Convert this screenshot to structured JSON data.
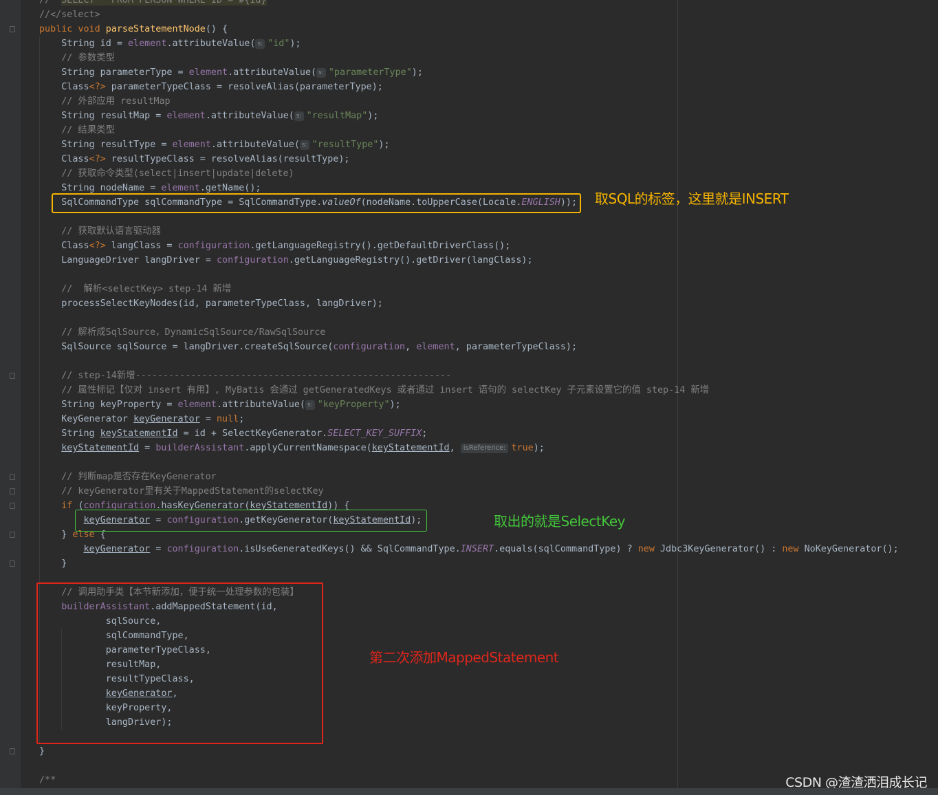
{
  "editor": {
    "lines": [
      [
        [
          "//  ",
          "cmt"
        ],
        [
          "SELECT * FROM PERSON WHERE ID = #{id}",
          "cmt hl"
        ]
      ],
      [
        [
          "//</select>",
          "cmt"
        ]
      ],
      [
        [
          "public void ",
          "kw"
        ],
        [
          "parseStatementNode",
          "fn"
        ],
        [
          "() {",
          ""
        ]
      ],
      [
        [
          "    String id = ",
          ""
        ],
        [
          "element",
          "fld"
        ],
        [
          ".attributeValue(",
          ""
        ],
        [
          "s:",
          "hint-s"
        ],
        [
          "\"id\"",
          "str"
        ],
        [
          ");",
          ""
        ]
      ],
      [
        [
          "    // 参数类型",
          "cmt"
        ]
      ],
      [
        [
          "    String parameterType = ",
          ""
        ],
        [
          "element",
          "fld"
        ],
        [
          ".attributeValue(",
          ""
        ],
        [
          "s:",
          "hint-s"
        ],
        [
          "\"parameterType\"",
          "str"
        ],
        [
          ");",
          ""
        ]
      ],
      [
        [
          "    Class",
          ""
        ],
        [
          "<?>",
          "kw"
        ],
        [
          " parameterTypeClass = resolveAlias(parameterType);",
          ""
        ]
      ],
      [
        [
          "    // 外部应用 resultMap",
          "cmt"
        ]
      ],
      [
        [
          "    String resultMap = ",
          ""
        ],
        [
          "element",
          "fld"
        ],
        [
          ".attributeValue(",
          ""
        ],
        [
          "s:",
          "hint-s"
        ],
        [
          "\"resultMap\"",
          "str"
        ],
        [
          ");",
          ""
        ]
      ],
      [
        [
          "    // 结果类型",
          "cmt"
        ]
      ],
      [
        [
          "    String resultType = ",
          ""
        ],
        [
          "element",
          "fld"
        ],
        [
          ".attributeValue(",
          ""
        ],
        [
          "s:",
          "hint-s"
        ],
        [
          "\"resultType\"",
          "str"
        ],
        [
          ");",
          ""
        ]
      ],
      [
        [
          "    Class",
          ""
        ],
        [
          "<?>",
          "kw"
        ],
        [
          " resultTypeClass = resolveAlias(resultType);",
          ""
        ]
      ],
      [
        [
          "    // 获取命令类型(select|insert|update|delete)",
          "cmt"
        ]
      ],
      [
        [
          "    String nodeName = ",
          ""
        ],
        [
          "element",
          "fld"
        ],
        [
          ".getName();",
          ""
        ]
      ],
      [
        [
          "    SqlCommandType sqlCommandType = SqlCommandType.",
          ""
        ],
        [
          "valueOf",
          "it"
        ],
        [
          "(nodeName.toUpperCase(Locale.",
          ""
        ],
        [
          "ENGLISH",
          "fld it"
        ],
        [
          "));",
          ""
        ]
      ],
      [],
      [
        [
          "    // 获取默认语言驱动器",
          "cmt"
        ]
      ],
      [
        [
          "    Class",
          ""
        ],
        [
          "<?>",
          "kw"
        ],
        [
          " langClass = ",
          ""
        ],
        [
          "configuration",
          "fld"
        ],
        [
          ".getLanguageRegistry().getDefaultDriverClass();",
          ""
        ]
      ],
      [
        [
          "    LanguageDriver langDriver = ",
          ""
        ],
        [
          "configuration",
          "fld"
        ],
        [
          ".getLanguageRegistry().getDriver(langClass);",
          ""
        ]
      ],
      [],
      [
        [
          "    //  解析<selectKey> step-14 新增",
          "cmt"
        ]
      ],
      [
        [
          "    processSelectKeyNodes(id, parameterTypeClass, langDriver);",
          ""
        ]
      ],
      [],
      [
        [
          "    // 解析成SqlSource，DynamicSqlSource/RawSqlSource",
          "cmt"
        ]
      ],
      [
        [
          "    SqlSource sqlSource = langDriver.createSqlSource(",
          ""
        ],
        [
          "configuration",
          "fld"
        ],
        [
          ", ",
          ""
        ],
        [
          "element",
          "fld"
        ],
        [
          ", parameterTypeClass);",
          ""
        ]
      ],
      [],
      [
        [
          "    // step-14新增---------------------------------------------------------",
          "cmt"
        ]
      ],
      [
        [
          "    // 属性标记【仅对 insert 有用】, MyBatis 会通过 getGeneratedKeys 或者通过 insert 语句的 selectKey 子元素设置它的值 step-14 新增",
          "cmt"
        ]
      ],
      [
        [
          "    String keyProperty = ",
          ""
        ],
        [
          "element",
          "fld"
        ],
        [
          ".attributeValue(",
          ""
        ],
        [
          "s:",
          "hint-s"
        ],
        [
          "\"keyProperty\"",
          "str"
        ],
        [
          ");",
          ""
        ]
      ],
      [
        [
          "    KeyGenerator ",
          ""
        ],
        [
          "keyGenerator",
          "u"
        ],
        [
          " = ",
          ""
        ],
        [
          "null",
          "kw"
        ],
        [
          ";",
          ""
        ]
      ],
      [
        [
          "    String ",
          ""
        ],
        [
          "keyStatementId",
          "u"
        ],
        [
          " = id + SelectKeyGenerator.",
          ""
        ],
        [
          "SELECT_KEY_SUFFIX",
          "fld it"
        ],
        [
          ";",
          ""
        ]
      ],
      [
        [
          "    ",
          ""
        ],
        [
          "keyStatementId",
          "u"
        ],
        [
          " = ",
          ""
        ],
        [
          "builderAssistant",
          "fld"
        ],
        [
          ".applyCurrentNamespace(",
          ""
        ],
        [
          "keyStatementId",
          "u"
        ],
        [
          ", ",
          ""
        ],
        [
          "isReference:",
          "hint"
        ],
        [
          "true",
          "kw"
        ],
        [
          ");",
          ""
        ]
      ],
      [],
      [
        [
          "    // 判断map是否存在KeyGenerator",
          "cmt"
        ]
      ],
      [
        [
          "    // keyGenerator里有关于MappedStatement的selectKey",
          "cmt"
        ]
      ],
      [
        [
          "    ",
          ""
        ],
        [
          "if ",
          "kw"
        ],
        [
          "(",
          ""
        ],
        [
          "configuration",
          "fld"
        ],
        [
          ".hasKeyGenerator(",
          ""
        ],
        [
          "keyStatementId",
          "u"
        ],
        [
          ")) {",
          ""
        ]
      ],
      [
        [
          "        ",
          ""
        ],
        [
          "keyGenerator",
          "u"
        ],
        [
          " = ",
          ""
        ],
        [
          "configuration",
          "fld"
        ],
        [
          ".getKeyGenerator(",
          ""
        ],
        [
          "keyStatementId",
          "u"
        ],
        [
          ");",
          ""
        ]
      ],
      [
        [
          "    } ",
          ""
        ],
        [
          "else ",
          "kw"
        ],
        [
          "{",
          ""
        ]
      ],
      [
        [
          "        ",
          ""
        ],
        [
          "keyGenerator",
          "u"
        ],
        [
          " = ",
          ""
        ],
        [
          "configuration",
          "fld"
        ],
        [
          ".isUseGeneratedKeys() && SqlCommandType.",
          ""
        ],
        [
          "INSERT",
          "fld it"
        ],
        [
          ".equals(sqlCommandType) ? ",
          ""
        ],
        [
          "new ",
          "kw"
        ],
        [
          "Jdbc3KeyGenerator() : ",
          ""
        ],
        [
          "new ",
          "kw"
        ],
        [
          "NoKeyGenerator();",
          ""
        ]
      ],
      [
        [
          "    }",
          ""
        ]
      ],
      [],
      [
        [
          "    // 调用助手类【本节新添加，便于统一处理参数的包装】",
          "cmt"
        ]
      ],
      [
        [
          "    ",
          ""
        ],
        [
          "builderAssistant",
          "fld"
        ],
        [
          ".addMappedStatement(id,",
          ""
        ]
      ],
      [
        [
          "            sqlSource,",
          ""
        ]
      ],
      [
        [
          "            sqlCommandType,",
          ""
        ]
      ],
      [
        [
          "            parameterTypeClass,",
          ""
        ]
      ],
      [
        [
          "            resultMap,",
          ""
        ]
      ],
      [
        [
          "            resultTypeClass,",
          ""
        ]
      ],
      [
        [
          "            ",
          ""
        ],
        [
          "keyGenerator",
          "u"
        ],
        [
          ",",
          ""
        ]
      ],
      [
        [
          "            keyProperty,",
          ""
        ]
      ],
      [
        [
          "            langDriver);",
          ""
        ]
      ],
      [],
      [
        [
          "}",
          ""
        ]
      ],
      [],
      [
        [
          "/**",
          "cmt"
        ]
      ]
    ]
  },
  "annotations": {
    "sql_label_note": "取SQL的标签，这里就是INSERT",
    "select_key_note": "取出的就是SelectKey",
    "mapped_statement_note": "第二次添加MappedStatement",
    "color_yellow": "#f5b400",
    "color_green": "#43c63a",
    "color_red": "#e0261b"
  },
  "watermark": "CSDN @渣渣洒泪成长记"
}
